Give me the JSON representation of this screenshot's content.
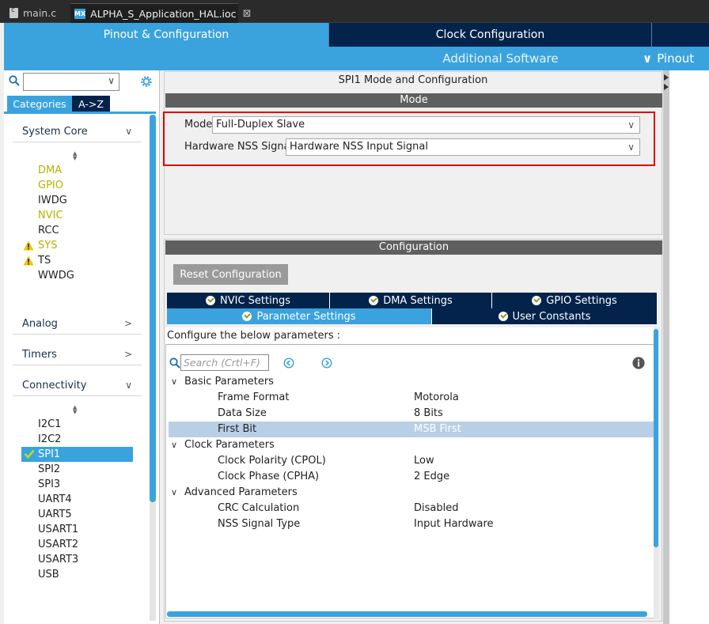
{
  "editor_tabs": [
    {
      "label": "main.c",
      "active": false
    },
    {
      "label": "ALPHA_S_Application_HAL.ioc",
      "active": true
    }
  ],
  "mx_badge": "MX",
  "nav": {
    "pinout_config": "Pinout & Configuration",
    "clock_config": "Clock Configuration",
    "additional_software": "Additional Software",
    "pinout_view": "Pinout"
  },
  "sidebar": {
    "view_buttons": {
      "categories": "Categories",
      "az": "A->Z"
    },
    "categories": [
      {
        "label": "System Core",
        "expanded": true
      },
      {
        "label": "Analog",
        "expanded": false
      },
      {
        "label": "Timers",
        "expanded": false
      },
      {
        "label": "Connectivity",
        "expanded": true
      }
    ],
    "system_core_items": [
      {
        "label": "DMA",
        "status": "configured"
      },
      {
        "label": "GPIO",
        "status": "configured"
      },
      {
        "label": "IWDG",
        "status": "none"
      },
      {
        "label": "NVIC",
        "status": "configured"
      },
      {
        "label": "RCC",
        "status": "none"
      },
      {
        "label": "SYS",
        "status": "warning"
      },
      {
        "label": "TS",
        "status": "warning"
      },
      {
        "label": "WWDG",
        "status": "none"
      }
    ],
    "connectivity_items": [
      {
        "label": "I2C1"
      },
      {
        "label": "I2C2"
      },
      {
        "label": "SPI1",
        "selected": true
      },
      {
        "label": "SPI2"
      },
      {
        "label": "SPI3"
      },
      {
        "label": "UART4"
      },
      {
        "label": "UART5"
      },
      {
        "label": "USART1"
      },
      {
        "label": "USART2"
      },
      {
        "label": "USART3"
      },
      {
        "label": "USB"
      }
    ]
  },
  "mode_panel": {
    "title": "SPI1 Mode and Configuration",
    "section": "Mode",
    "mode_label": "Mode",
    "mode_value": "Full-Duplex Slave",
    "nss_label": "Hardware NSS Signal",
    "nss_value": "Hardware NSS Input Signal"
  },
  "config_panel": {
    "section": "Configuration",
    "reset_button": "Reset Configuration",
    "tabs_row1": [
      "NVIC Settings",
      "DMA Settings",
      "GPIO Settings"
    ],
    "tabs_row2": [
      "Parameter Settings",
      "User Constants"
    ],
    "active_tab": "Parameter Settings",
    "instruction": "Configure the below parameters :",
    "search_placeholder": "Search (Crtl+F)",
    "groups": [
      {
        "name": "Basic Parameters",
        "params": [
          {
            "name": "Frame Format",
            "value": "Motorola"
          },
          {
            "name": "Data Size",
            "value": "8 Bits"
          },
          {
            "name": "First Bit",
            "value": "MSB First",
            "selected": true
          }
        ]
      },
      {
        "name": "Clock Parameters",
        "params": [
          {
            "name": "Clock Polarity (CPOL)",
            "value": "Low"
          },
          {
            "name": "Clock Phase (CPHA)",
            "value": "2 Edge"
          }
        ]
      },
      {
        "name": "Advanced Parameters",
        "params": [
          {
            "name": "CRC Calculation",
            "value": "Disabled"
          },
          {
            "name": "NSS Signal Type",
            "value": "Input Hardware"
          }
        ]
      }
    ]
  },
  "colors": {
    "accent": "#3aa3de",
    "navy": "#03234b",
    "highlight_border": "#e00000",
    "configured_text": "#b4b400",
    "warning": "#f2c500"
  },
  "icons": {
    "search": "search-icon",
    "settings": "gear-icon",
    "warning": "warning-icon",
    "check": "check-icon",
    "info": "info-icon",
    "prev": "previous-icon",
    "next": "next-icon",
    "dropdown": "chevron-down-icon",
    "expand": "chevron-right-icon"
  }
}
